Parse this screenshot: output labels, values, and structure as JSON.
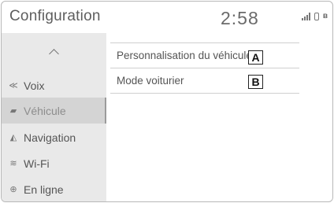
{
  "header": {
    "title": "Configuration",
    "clock": "2:58",
    "status_icons": [
      "signal-bars-icon",
      "phone-icon",
      "bluetooth-icon"
    ],
    "bluetooth_glyph": "ʙ"
  },
  "sidebar": {
    "scroll_up_icon": "chevron-up-icon",
    "items": [
      {
        "label": "Voix",
        "icon": "voice-icon",
        "glyph": "≪",
        "selected": false
      },
      {
        "label": "Véhicule",
        "icon": "car-icon",
        "glyph": "▰",
        "selected": true
      },
      {
        "label": "Navigation",
        "icon": "navigation-icon",
        "glyph": "◭",
        "selected": false
      },
      {
        "label": "Wi-Fi",
        "icon": "wifi-icon",
        "glyph": "≋",
        "selected": false
      },
      {
        "label": "En ligne",
        "icon": "globe-icon",
        "glyph": "⊕",
        "selected": false
      }
    ]
  },
  "main": {
    "rows": [
      {
        "label": "Personnalisation du véhicule",
        "callout": "A"
      },
      {
        "label": "Mode voiturier",
        "callout": "B"
      }
    ]
  }
}
